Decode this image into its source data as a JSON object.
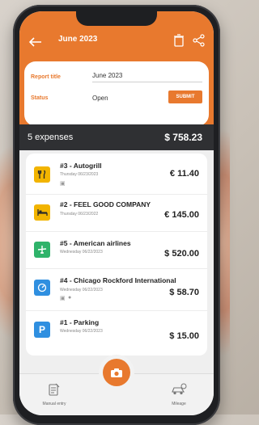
{
  "header": {
    "title": "June 2023"
  },
  "report": {
    "title_label": "Report title",
    "title_value": "June 2023",
    "status_label": "Status",
    "status_value": "Open",
    "submit_label": "SUBMIT"
  },
  "summary": {
    "count": "5 expenses",
    "total": "$ 758.23"
  },
  "expenses": [
    {
      "title": "#3 - Autogrill",
      "date": "Thursday 06/23/2023",
      "amount": "€ 11.40",
      "icon": "fork-knife-icon",
      "color": "#f2b400",
      "extras": [
        "receipt-icon"
      ]
    },
    {
      "title": "#2 - FEEL GOOD COMPANY",
      "date": "Thursday 06/23/2022",
      "amount": "€ 145.00",
      "icon": "bed-icon",
      "color": "#f2b400",
      "extras": []
    },
    {
      "title": "#5 - American airlines",
      "date": "Wednesday 06/22/2023",
      "amount": "$ 520.00",
      "icon": "plane-icon",
      "color": "#2fb36a",
      "extras": []
    },
    {
      "title": "#4 - Chicago Rockford International",
      "date": "Wednesday 06/22/2023",
      "amount": "$ 58.70",
      "icon": "gauge-icon",
      "color": "#2f8fe0",
      "extras": [
        "receipt-icon",
        "comment-icon"
      ]
    },
    {
      "title": "#1 - Parking",
      "date": "Wednesday 06/22/2023",
      "amount": "$ 15.00",
      "icon": "parking-icon",
      "color": "#2f8fe0",
      "extras": []
    }
  ],
  "bottom": {
    "manual_label": "Manual entry",
    "mileage_label": "Mileage"
  },
  "colors": {
    "accent": "#e8792e",
    "dark_bar": "#2f3033"
  }
}
